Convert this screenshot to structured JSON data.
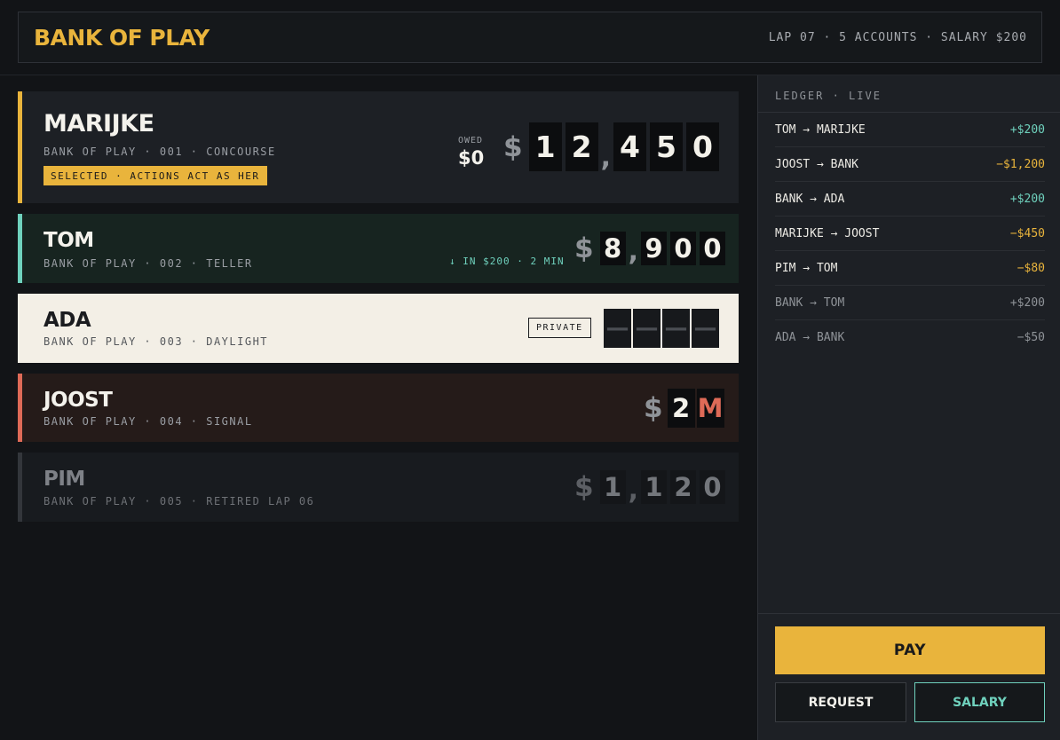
{
  "header": {
    "brand": "BANK OF PLAY",
    "meta": "LAP 07 · 5 ACCOUNTS · SALARY $200"
  },
  "accounts": [
    {
      "name": "MARIJKE",
      "sub": "BANK OF PLAY · 001 · CONCOURSE",
      "badge": "SELECTED · ACTIONS ACT AS HER",
      "owed_label": "OWED",
      "owed_value": "$0",
      "currency": "$",
      "digits": [
        "1",
        "2",
        ",",
        "4",
        "5",
        "0"
      ]
    },
    {
      "name": "TOM",
      "sub": "BANK OF PLAY · 002 · TELLER",
      "incoming": "↓ IN $200 · 2 MIN",
      "currency": "$",
      "digits": [
        "8",
        ",",
        "9",
        "0",
        "0"
      ]
    },
    {
      "name": "ADA",
      "sub": "BANK OF PLAY · 003 · DAYLIGHT",
      "private_label": "PRIVATE",
      "digits": [
        "—",
        "—",
        "—",
        "—"
      ]
    },
    {
      "name": "JOOST",
      "sub": "BANK OF PLAY · 004 · SIGNAL",
      "currency": "$",
      "digits": [
        "2",
        "M"
      ]
    },
    {
      "name": "PIM",
      "sub": "BANK OF PLAY · 005 · RETIRED LAP 06",
      "currency": "$",
      "digits": [
        "1",
        ",",
        "1",
        "2",
        "0"
      ]
    }
  ],
  "ledger": {
    "title": "LEDGER · LIVE",
    "rows": [
      {
        "party": "TOM → MARIJKE",
        "amount": "+$200"
      },
      {
        "party": "JOOST → BANK",
        "amount": "−$1,200"
      },
      {
        "party": "BANK → ADA",
        "amount": "+$200"
      },
      {
        "party": "MARIJKE → JOOST",
        "amount": "−$450"
      },
      {
        "party": "PIM → TOM",
        "amount": "−$80"
      },
      {
        "party": "BANK → TOM",
        "amount": "+$200"
      },
      {
        "party": "ADA → BANK",
        "amount": "−$50"
      }
    ]
  },
  "actions": {
    "pay": "PAY",
    "request": "REQUEST",
    "salary": "SALARY"
  },
  "colors": {
    "accent": "#e9b43c",
    "teal": "#6fd1bd",
    "red": "#de6a57"
  }
}
